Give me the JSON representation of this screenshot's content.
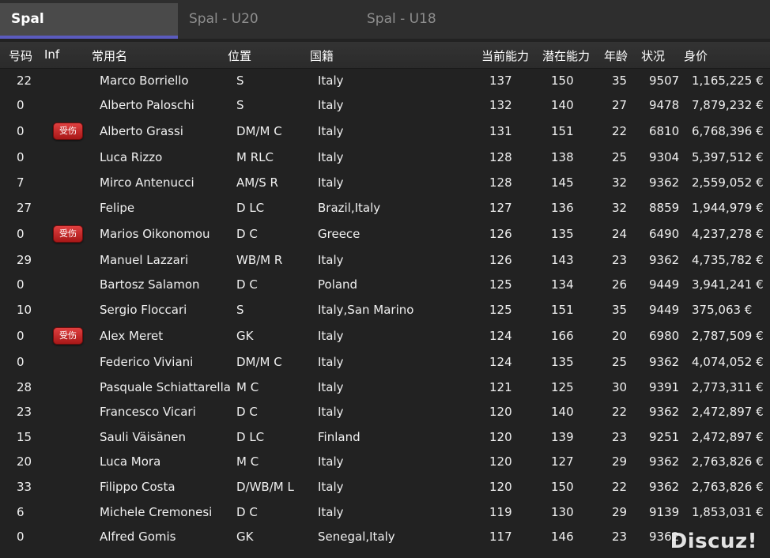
{
  "tabs": [
    {
      "label": "Spal",
      "active": true
    },
    {
      "label": "Spal - U20",
      "active": false
    },
    {
      "label": "Spal - U18",
      "active": false
    }
  ],
  "columns": {
    "number": "号码",
    "inf": "Inf",
    "name": "常用名",
    "position": "位置",
    "nationality": "国籍",
    "ca": "当前能力",
    "pa": "潜在能力",
    "age": "年龄",
    "condition": "状况",
    "value": "身价"
  },
  "injury_label": "受伤",
  "players": [
    {
      "number": "22",
      "injured": false,
      "name": "Marco Borriello",
      "position": "S",
      "nationality": "Italy",
      "ca": "137",
      "pa": "150",
      "age": "35",
      "condition": "9507",
      "value": "1,165,225 €"
    },
    {
      "number": "0",
      "injured": false,
      "name": "Alberto Paloschi",
      "position": "S",
      "nationality": "Italy",
      "ca": "132",
      "pa": "140",
      "age": "27",
      "condition": "9478",
      "value": "7,879,232 €"
    },
    {
      "number": "0",
      "injured": true,
      "name": "Alberto Grassi",
      "position": "DM/M C",
      "nationality": "Italy",
      "ca": "131",
      "pa": "151",
      "age": "22",
      "condition": "6810",
      "value": "6,768,396 €"
    },
    {
      "number": "0",
      "injured": false,
      "name": "Luca Rizzo",
      "position": "M RLC",
      "nationality": "Italy",
      "ca": "128",
      "pa": "138",
      "age": "25",
      "condition": "9304",
      "value": "5,397,512 €"
    },
    {
      "number": "7",
      "injured": false,
      "name": "Mirco Antenucci",
      "position": "AM/S R",
      "nationality": "Italy",
      "ca": "128",
      "pa": "145",
      "age": "32",
      "condition": "9362",
      "value": "2,559,052 €"
    },
    {
      "number": "27",
      "injured": false,
      "name": "Felipe",
      "position": "D LC",
      "nationality": "Brazil,Italy",
      "ca": "127",
      "pa": "136",
      "age": "32",
      "condition": "8859",
      "value": "1,944,979 €"
    },
    {
      "number": "0",
      "injured": true,
      "name": "Marios Oikonomou",
      "position": "D C",
      "nationality": "Greece",
      "ca": "126",
      "pa": "135",
      "age": "24",
      "condition": "6490",
      "value": "4,237,278 €"
    },
    {
      "number": "29",
      "injured": false,
      "name": "Manuel Lazzari",
      "position": "WB/M R",
      "nationality": "Italy",
      "ca": "126",
      "pa": "143",
      "age": "23",
      "condition": "9362",
      "value": "4,735,782 €"
    },
    {
      "number": "0",
      "injured": false,
      "name": "Bartosz Salamon",
      "position": "D C",
      "nationality": "Poland",
      "ca": "125",
      "pa": "134",
      "age": "26",
      "condition": "9449",
      "value": "3,941,241 €"
    },
    {
      "number": "10",
      "injured": false,
      "name": "Sergio Floccari",
      "position": "S",
      "nationality": "Italy,San Marino",
      "ca": "125",
      "pa": "151",
      "age": "35",
      "condition": "9449",
      "value": "375,063 €"
    },
    {
      "number": "0",
      "injured": true,
      "name": "Alex Meret",
      "position": "GK",
      "nationality": "Italy",
      "ca": "124",
      "pa": "166",
      "age": "20",
      "condition": "6980",
      "value": "2,787,509 €"
    },
    {
      "number": "0",
      "injured": false,
      "name": "Federico Viviani",
      "position": "DM/M C",
      "nationality": "Italy",
      "ca": "124",
      "pa": "135",
      "age": "25",
      "condition": "9362",
      "value": "4,074,052 €"
    },
    {
      "number": "28",
      "injured": false,
      "name": "Pasquale Schiattarella",
      "position": "M C",
      "nationality": "Italy",
      "ca": "121",
      "pa": "125",
      "age": "30",
      "condition": "9391",
      "value": "2,773,311 €"
    },
    {
      "number": "23",
      "injured": false,
      "name": "Francesco Vicari",
      "position": "D C",
      "nationality": "Italy",
      "ca": "120",
      "pa": "140",
      "age": "22",
      "condition": "9362",
      "value": "2,472,897 €"
    },
    {
      "number": "15",
      "injured": false,
      "name": "Sauli Väisänen",
      "position": "D LC",
      "nationality": "Finland",
      "ca": "120",
      "pa": "139",
      "age": "23",
      "condition": "9251",
      "value": "2,472,897 €"
    },
    {
      "number": "20",
      "injured": false,
      "name": "Luca Mora",
      "position": "M C",
      "nationality": "Italy",
      "ca": "120",
      "pa": "127",
      "age": "29",
      "condition": "9362",
      "value": "2,763,826 €"
    },
    {
      "number": "33",
      "injured": false,
      "name": "Filippo Costa",
      "position": "D/WB/M L",
      "nationality": "Italy",
      "ca": "120",
      "pa": "150",
      "age": "22",
      "condition": "9362",
      "value": "2,763,826 €"
    },
    {
      "number": "6",
      "injured": false,
      "name": "Michele Cremonesi",
      "position": "D C",
      "nationality": "Italy",
      "ca": "119",
      "pa": "130",
      "age": "29",
      "condition": "9139",
      "value": "1,853,031 €"
    },
    {
      "number": "0",
      "injured": false,
      "name": "Alfred Gomis",
      "position": "GK",
      "nationality": "Senegal,Italy",
      "ca": "117",
      "pa": "146",
      "age": "23",
      "condition": "9362",
      "value": ""
    }
  ],
  "watermark": "Discuz!"
}
